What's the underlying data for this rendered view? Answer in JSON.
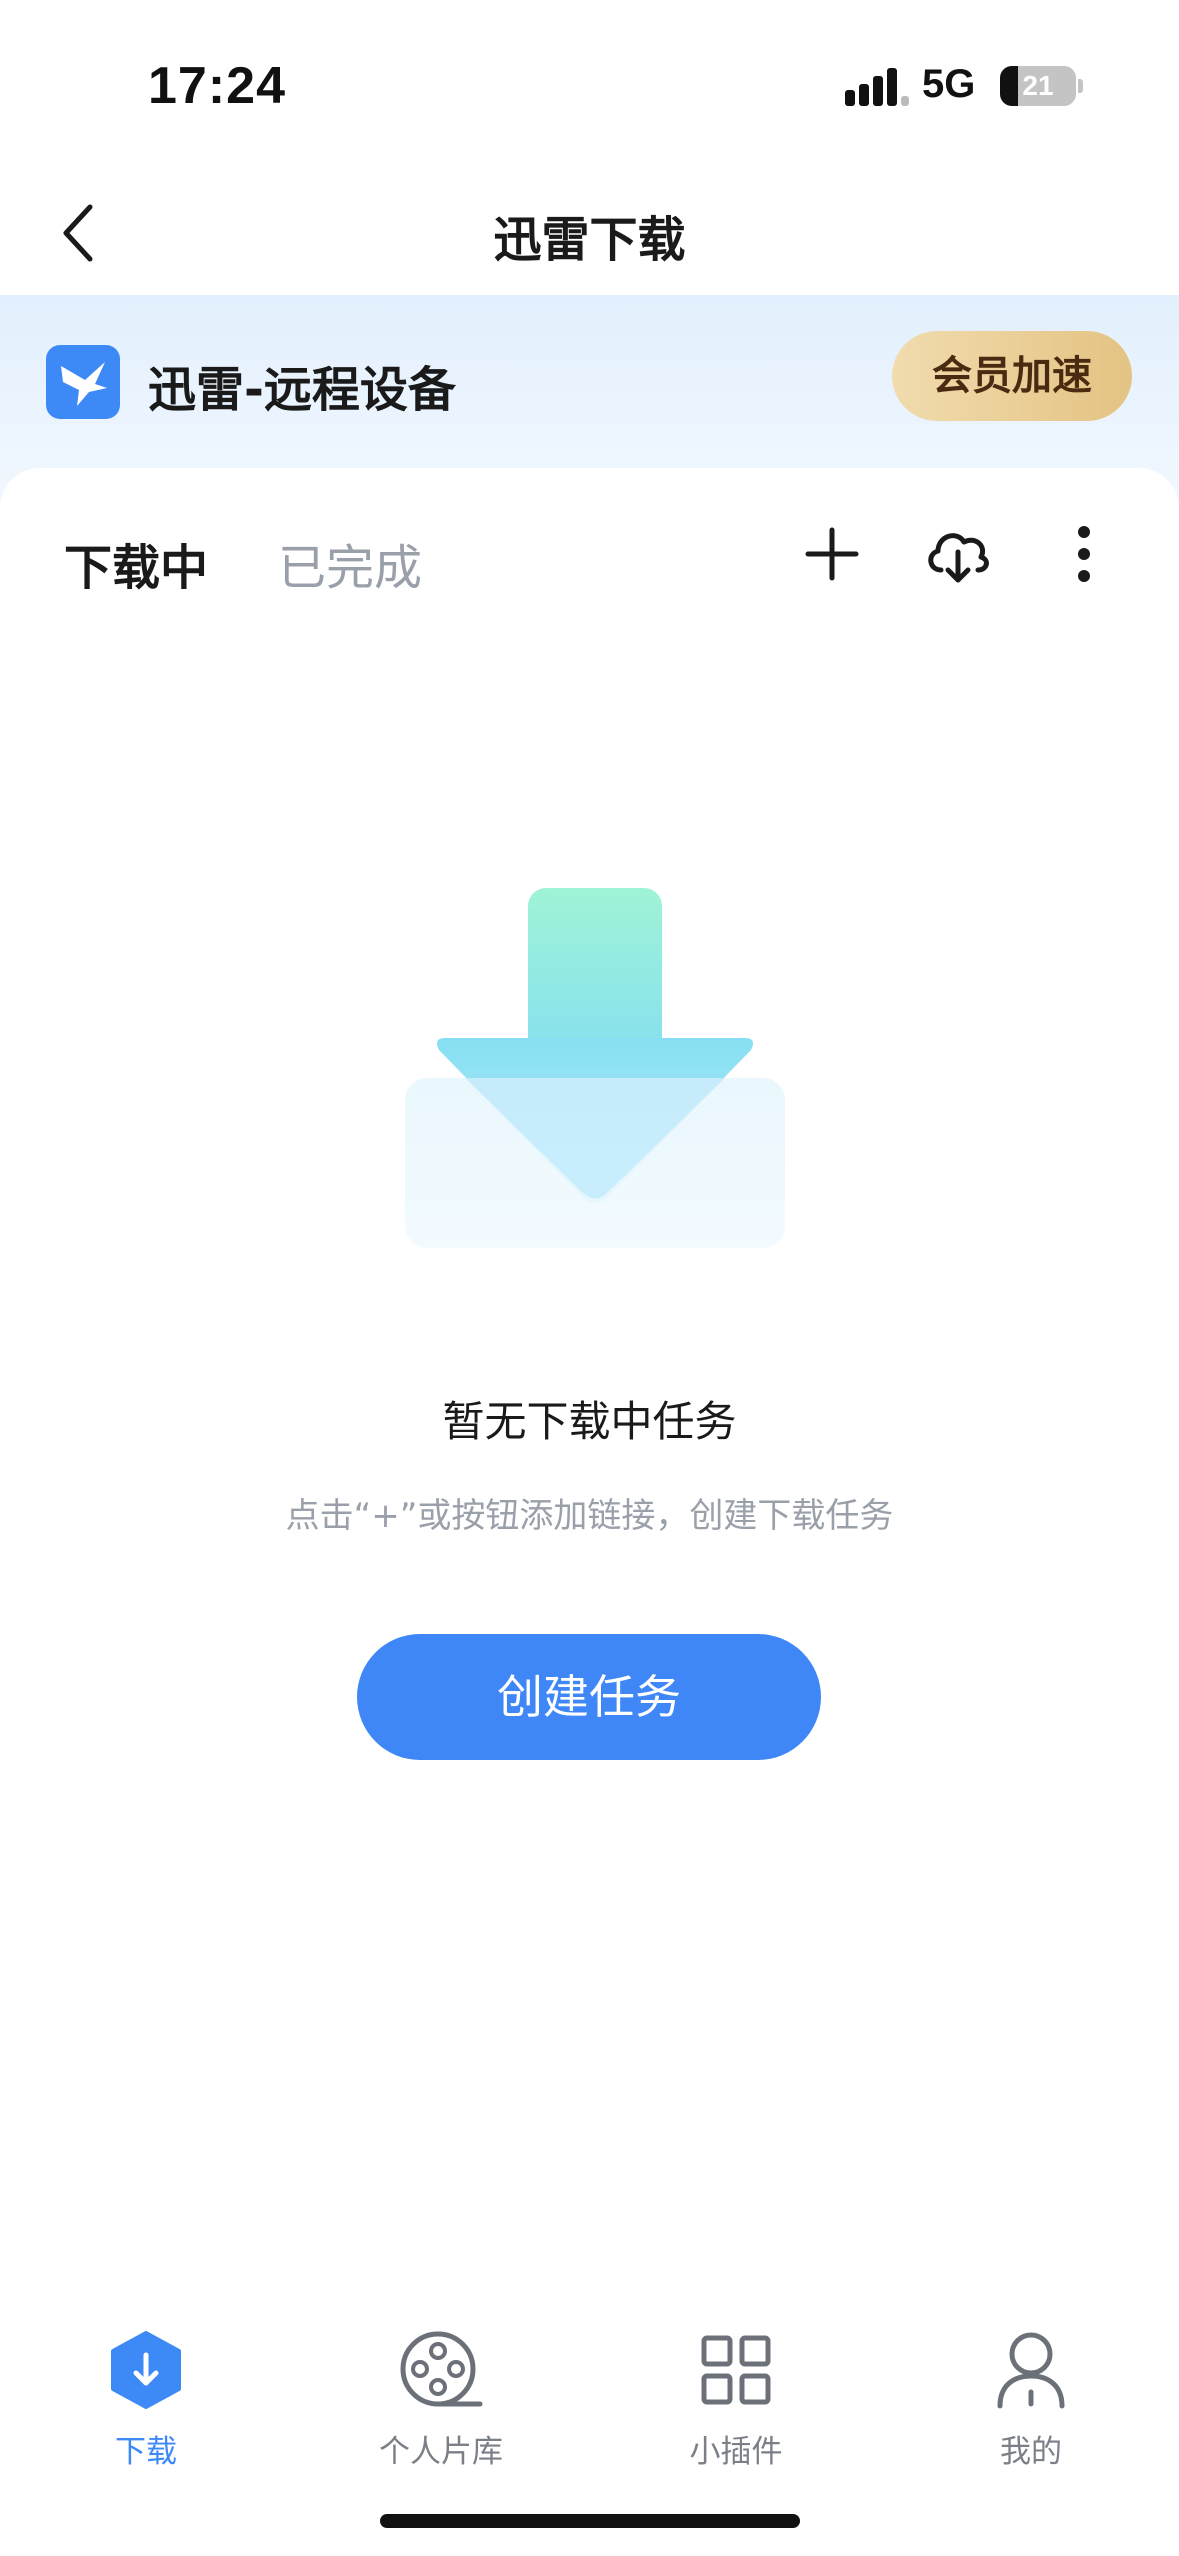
{
  "status_bar": {
    "time": "17:24",
    "network": "5G",
    "battery": "21"
  },
  "nav": {
    "title": "迅雷下载"
  },
  "banner": {
    "device_name": "迅雷-远程设备",
    "vip_label": "会员加速"
  },
  "tabs": {
    "downloading": "下载中",
    "completed": "已完成"
  },
  "empty_state": {
    "title": "暂无下载中任务",
    "hint": "点击“+”或按钮添加链接，创建下载任务",
    "button": "创建任务"
  },
  "tab_bar": {
    "items": [
      {
        "label": "下载",
        "icon": "download-hexagon-icon",
        "active": true
      },
      {
        "label": "个人片库",
        "icon": "film-reel-icon",
        "active": false
      },
      {
        "label": "小插件",
        "icon": "grid-icon",
        "active": false
      },
      {
        "label": "我的",
        "icon": "person-icon",
        "active": false
      }
    ]
  },
  "colors": {
    "accent": "#3f87f7",
    "vip_gold": "#e4c383",
    "muted_text": "#9aa0aa",
    "banner_bg": "#e2f0fd"
  }
}
